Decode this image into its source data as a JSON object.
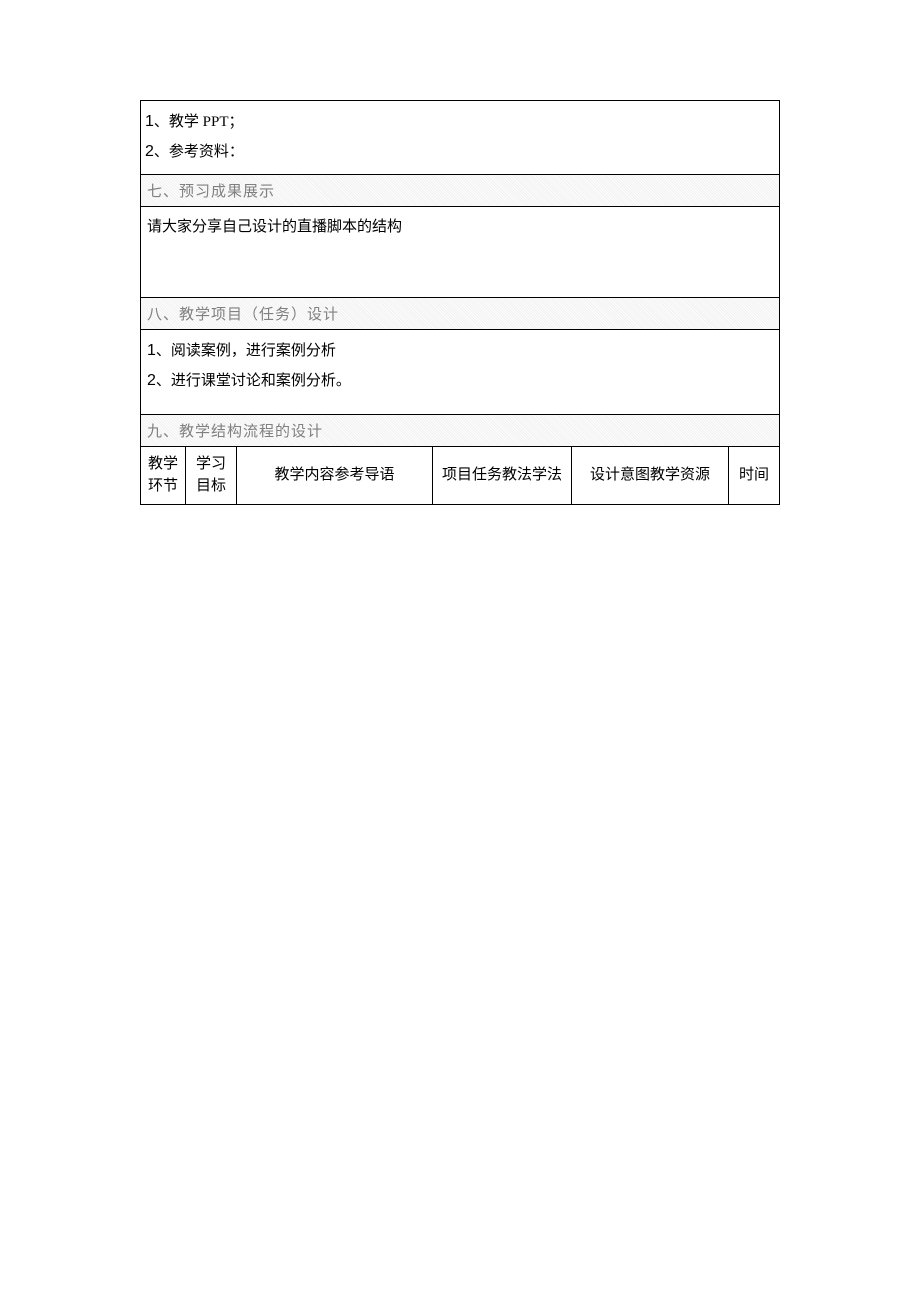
{
  "section_top": {
    "line1_prefix": "1",
    "line1_text": "、教学 PPT；",
    "line2_prefix": "2",
    "line2_text": "、参考资料："
  },
  "section7": {
    "heading": "七、预习成果展示",
    "body": "请大家分享自己设计的直播脚本的结构"
  },
  "section8": {
    "heading": "八、教学项目（任务）设计",
    "line1_prefix": "1",
    "line1_text": "、阅读案例，进行案例分析",
    "line2_prefix": "2",
    "line2_text": "、进行课堂讨论和案例分析。"
  },
  "section9": {
    "heading": "九、教学结构流程的设计",
    "headers": {
      "c1": "教学环节",
      "c2": "学习目标",
      "c3": "教学内容参考导语",
      "c4": "项目任务教法学法",
      "c5": "设计意图教学资源",
      "c6": "时间"
    }
  }
}
